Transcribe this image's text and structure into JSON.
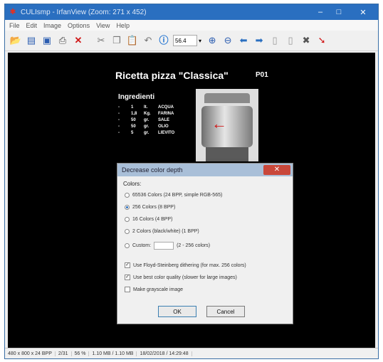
{
  "window": {
    "title": "CULIsmp - IrfanView (Zoom: 271 x 452)",
    "min_glyph": "–",
    "max_glyph": "□",
    "close_glyph": "✕"
  },
  "menu": [
    "File",
    "Edit",
    "Image",
    "Options",
    "View",
    "Help"
  ],
  "toolbar": {
    "zoom_value": "56.4",
    "icons": [
      "open-folder-icon",
      "slideshow-icon",
      "save-icon",
      "print-icon",
      "delete-icon",
      "cut-icon",
      "copy-icon",
      "paste-icon",
      "undo-icon",
      "info-icon",
      "zoom-in-icon",
      "zoom-out-icon",
      "previous-icon",
      "next-icon",
      "page-icon",
      "page-alt-icon",
      "tools-icon",
      "exit-icon"
    ]
  },
  "document": {
    "title": "Ricetta pizza \"Classica\"",
    "code": "P01",
    "ingredients_title": "Ingredienti",
    "ingredients": [
      {
        "bullet": "-",
        "qty": "1",
        "unit": "lt.",
        "name": "ACQUA"
      },
      {
        "bullet": "-",
        "qty": "1,8",
        "unit": "Kg.",
        "name": "FARINA"
      },
      {
        "bullet": "-",
        "qty": "50",
        "unit": "gr.",
        "name": "SALE"
      },
      {
        "bullet": "-",
        "qty": "50",
        "unit": "gr.",
        "name": "OLIO"
      },
      {
        "bullet": "-",
        "qty": "5",
        "unit": "gr.",
        "name": "LIEVITO"
      }
    ],
    "photo_arrow": "←"
  },
  "dialog": {
    "title": "Decrease color depth",
    "close_glyph": "✕",
    "group_label": "Colors:",
    "options": [
      {
        "label": "65536 Colors (24 BPP, simple RGB-565)",
        "selected": false
      },
      {
        "label": "256 Colors (8 BPP)",
        "selected": true
      },
      {
        "label": "16 Colors (4 BPP)",
        "selected": false
      },
      {
        "label": "2 Colors (black/white) (1 BPP)",
        "selected": false
      }
    ],
    "custom_label": "Custom:",
    "custom_hint": "(2 - 256 colors)",
    "checks": [
      {
        "label": "Use Floyd-Steinberg dithering (for max. 256 colors)",
        "checked": true
      },
      {
        "label": "Use best color quality (slower for large images)",
        "checked": true
      },
      {
        "label": "Make grayscale image",
        "checked": false
      }
    ],
    "ok_label": "OK",
    "cancel_label": "Cancel"
  },
  "status": {
    "dimensions": "480 x 800 x 24 BPP",
    "index": "2/31",
    "zoom": "56 %",
    "size": "1.10 MB / 1.10 MB",
    "date": "18/02/2018 / 14:29:48"
  },
  "colors": {
    "titlebar": "#2a6fc0",
    "canvas": "#000000",
    "dialog_close": "#c9473a",
    "accent_red": "#d01818"
  }
}
